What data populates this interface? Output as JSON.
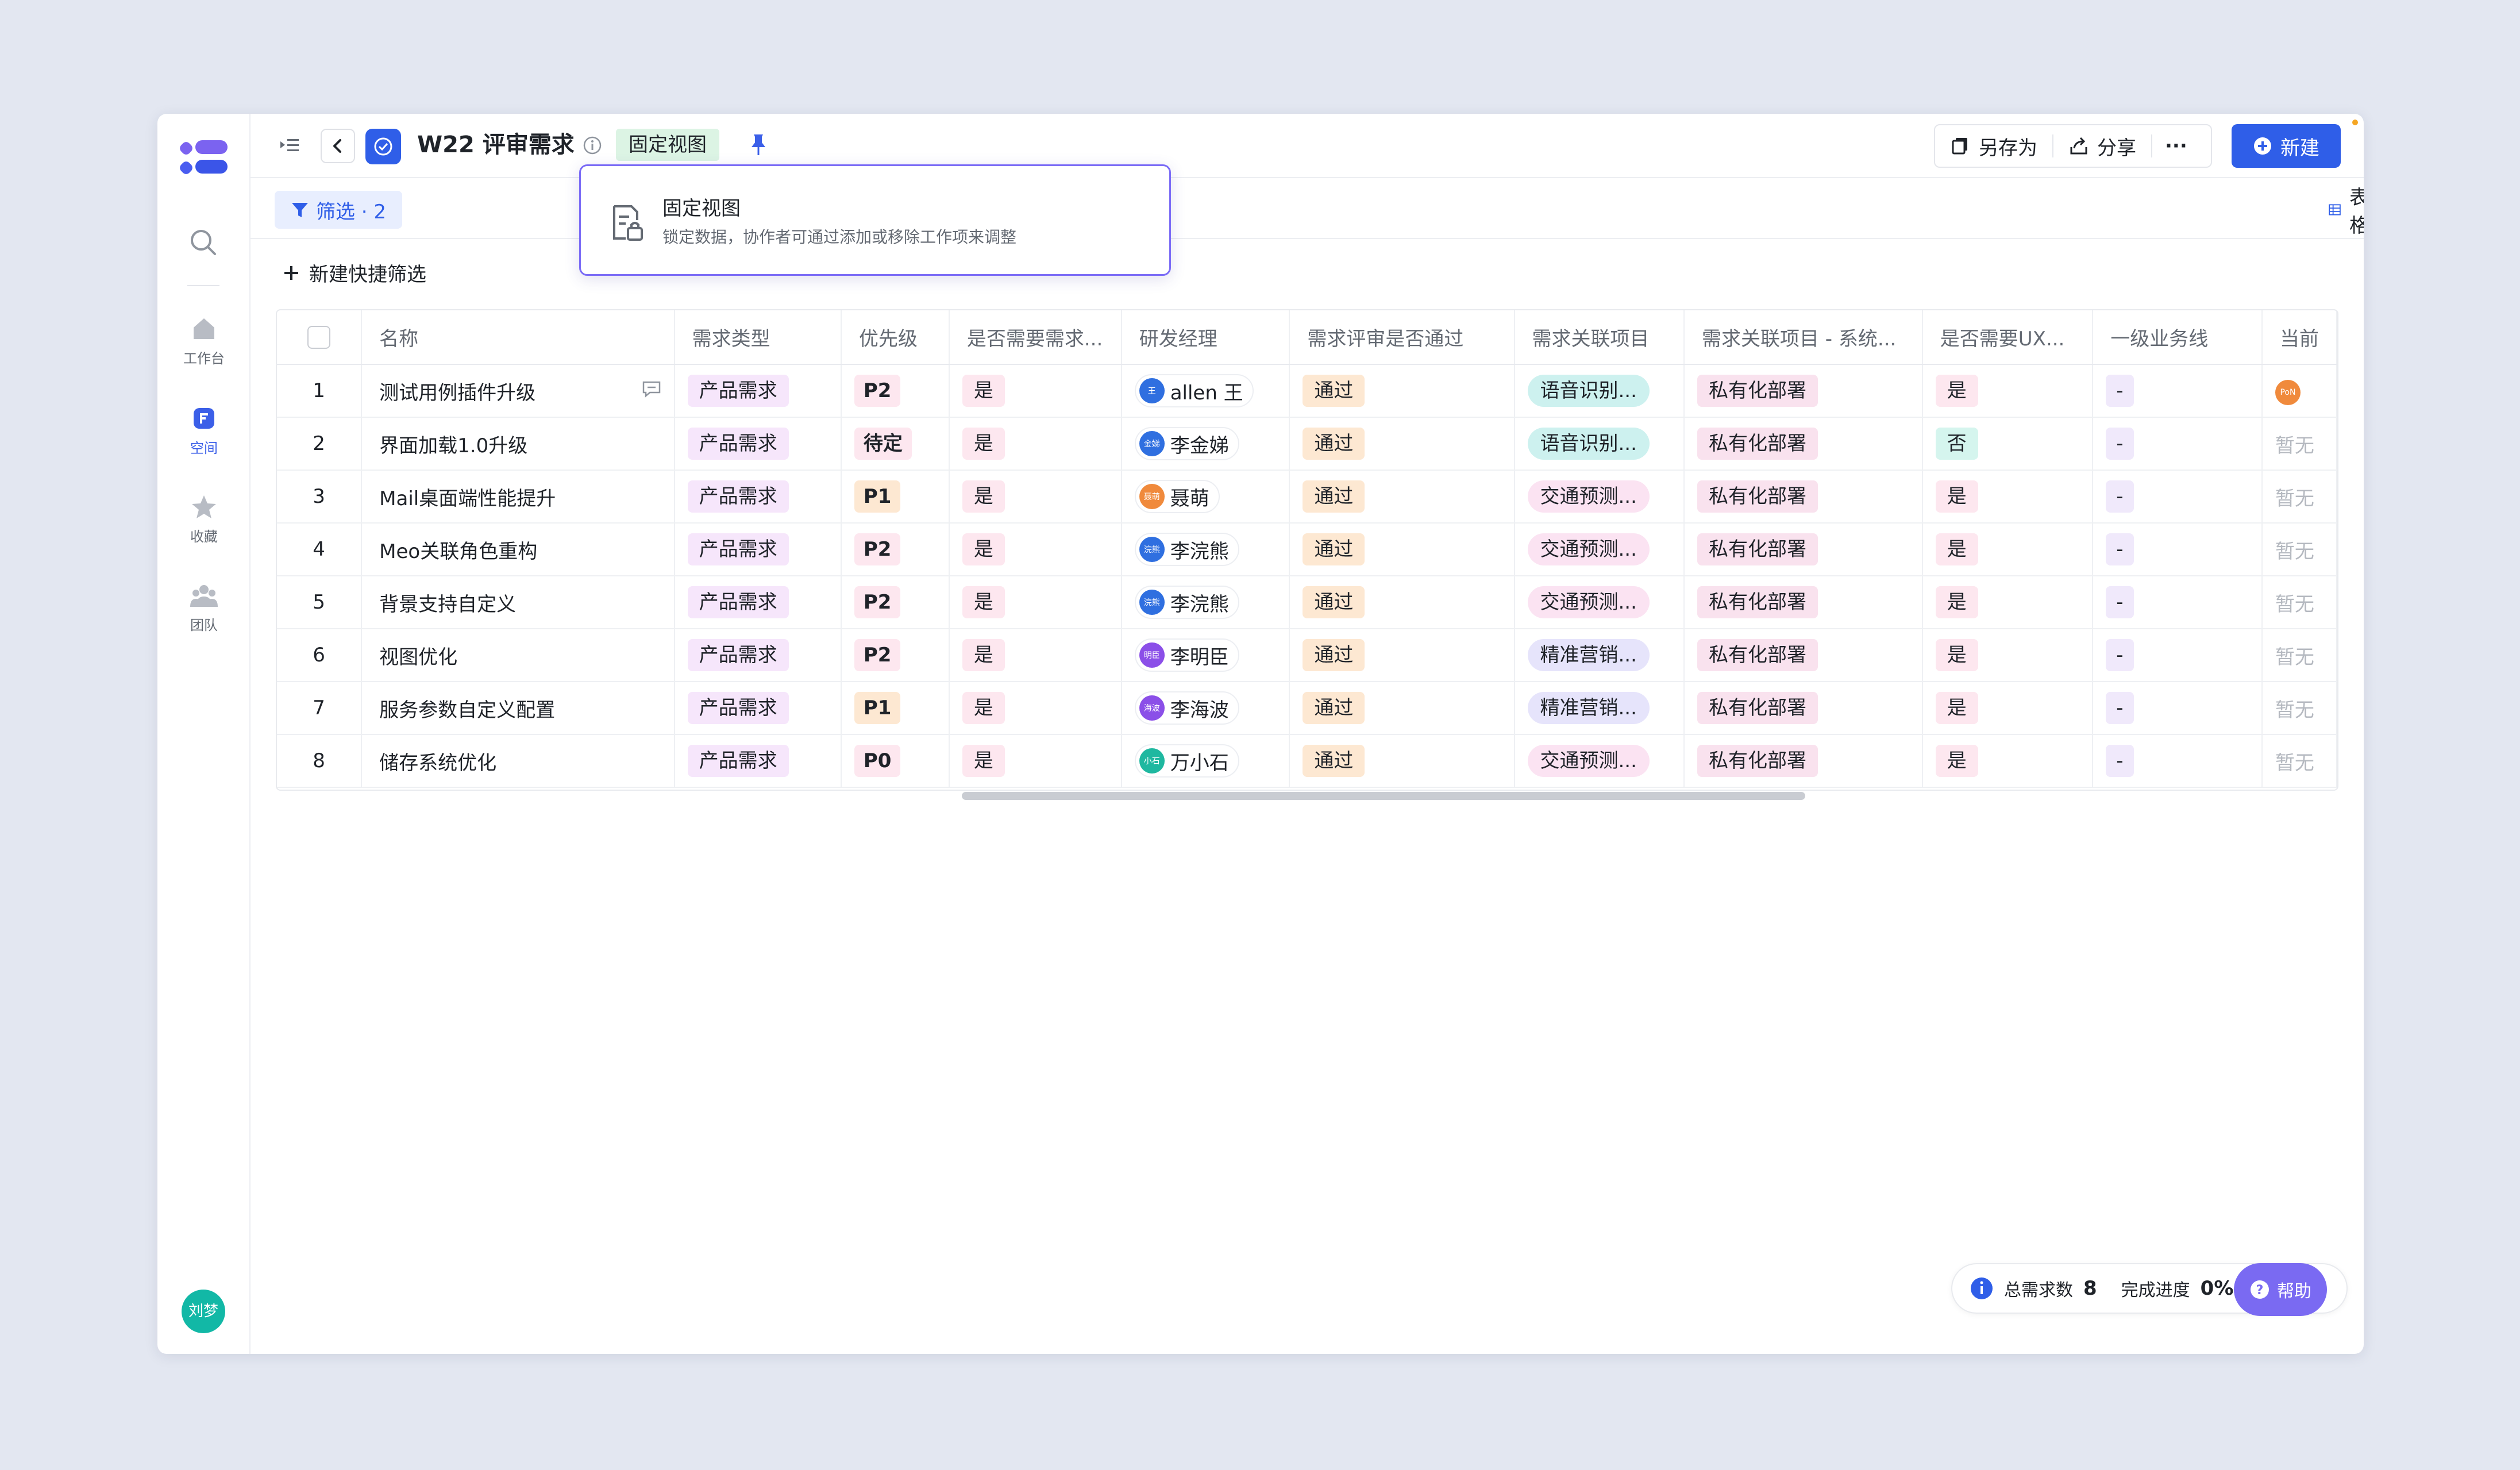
{
  "sidebar": {
    "items": [
      {
        "label": "工作台",
        "icon": "home-icon"
      },
      {
        "label": "空间",
        "icon": "space-icon",
        "active": true
      },
      {
        "label": "收藏",
        "icon": "star-icon"
      },
      {
        "label": "团队",
        "icon": "team-icon"
      }
    ],
    "user_avatar": "刘梦"
  },
  "header": {
    "title": "W22 评审需求",
    "view_badge": "固定视图",
    "save_as": "另存为",
    "share": "分享",
    "more": "···",
    "new": "新建"
  },
  "popover": {
    "title": "固定视图",
    "desc": "锁定数据，协作者可通过添加或移除工作项来调整"
  },
  "toolbar": {
    "filter": "筛选 · 2",
    "quick_filter": "新建快捷筛选",
    "view": "表格"
  },
  "table": {
    "columns": [
      "名称",
      "需求类型",
      "优先级",
      "是否需要需求...",
      "研发经理",
      "需求评审是否通过",
      "需求关联项目",
      "需求关联项目 - 系统...",
      "是否需要UX...",
      "一级业务线",
      "当前"
    ],
    "rows": [
      {
        "no": "1",
        "name": "测试用例插件升级",
        "type": "产品需求",
        "priority": "P2",
        "need": "是",
        "manager": "allen 王",
        "avatar": "王",
        "avatar_color": "#2f6fe0",
        "review": "通过",
        "project": "语音识别...",
        "project_style": "cyan",
        "system": "私有化部署",
        "ux": "是",
        "ux_style": "pink",
        "line": "-",
        "current": "PoN",
        "current_style": "avatar"
      },
      {
        "no": "2",
        "name": "界面加载1.0升级",
        "type": "产品需求",
        "priority": "待定",
        "need": "是",
        "manager": "李金娣",
        "avatar": "金娣",
        "avatar_color": "#2f6fe0",
        "review": "通过",
        "project": "语音识别...",
        "project_style": "cyan",
        "system": "私有化部署",
        "ux": "否",
        "ux_style": "teal",
        "line": "-",
        "current": "暂无",
        "current_style": "muted"
      },
      {
        "no": "3",
        "name": "Mail桌面端性能提升",
        "type": "产品需求",
        "priority": "P1",
        "need": "是",
        "manager": "聂萌",
        "avatar": "聂萌",
        "avatar_color": "#f08a3c",
        "review": "通过",
        "project": "交通预测...",
        "project_style": "pink",
        "system": "私有化部署",
        "ux": "是",
        "ux_style": "pink",
        "line": "-",
        "current": "暂无",
        "current_style": "muted"
      },
      {
        "no": "4",
        "name": "Meo关联角色重构",
        "type": "产品需求",
        "priority": "P2",
        "need": "是",
        "manager": "李浣熊",
        "avatar": "浣熊",
        "avatar_color": "#2f6fe0",
        "review": "通过",
        "project": "交通预测...",
        "project_style": "pink",
        "system": "私有化部署",
        "ux": "是",
        "ux_style": "pink",
        "line": "-",
        "current": "暂无",
        "current_style": "muted"
      },
      {
        "no": "5",
        "name": "背景支持自定义",
        "type": "产品需求",
        "priority": "P2",
        "need": "是",
        "manager": "李浣熊",
        "avatar": "浣熊",
        "avatar_color": "#2f6fe0",
        "review": "通过",
        "project": "交通预测...",
        "project_style": "pink",
        "system": "私有化部署",
        "ux": "是",
        "ux_style": "pink",
        "line": "-",
        "current": "暂无",
        "current_style": "muted"
      },
      {
        "no": "6",
        "name": "视图优化",
        "type": "产品需求",
        "priority": "P2",
        "need": "是",
        "manager": "李明臣",
        "avatar": "明臣",
        "avatar_color": "#8b4fe8",
        "review": "通过",
        "project": "精准营销...",
        "project_style": "purple",
        "system": "私有化部署",
        "ux": "是",
        "ux_style": "pink",
        "line": "-",
        "current": "暂无",
        "current_style": "muted"
      },
      {
        "no": "7",
        "name": "服务参数自定义配置",
        "type": "产品需求",
        "priority": "P1",
        "need": "是",
        "manager": "李海波",
        "avatar": "海波",
        "avatar_color": "#8b4fe8",
        "review": "通过",
        "project": "精准营销...",
        "project_style": "purple",
        "system": "私有化部署",
        "ux": "是",
        "ux_style": "pink",
        "line": "-",
        "current": "暂无",
        "current_style": "muted"
      },
      {
        "no": "8",
        "name": "储存系统优化",
        "type": "产品需求",
        "priority": "P0",
        "need": "是",
        "manager": "万小石",
        "avatar": "小石",
        "avatar_color": "#1fb8a0",
        "review": "通过",
        "project": "交通预测...",
        "project_style": "pink",
        "system": "私有化部署",
        "ux": "是",
        "ux_style": "pink",
        "line": "-",
        "current": "暂无",
        "current_style": "muted"
      }
    ]
  },
  "footer": {
    "total_label": "总需求数",
    "total": "8",
    "progress_label": "完成进度",
    "progress": "0%",
    "help": "帮助"
  }
}
